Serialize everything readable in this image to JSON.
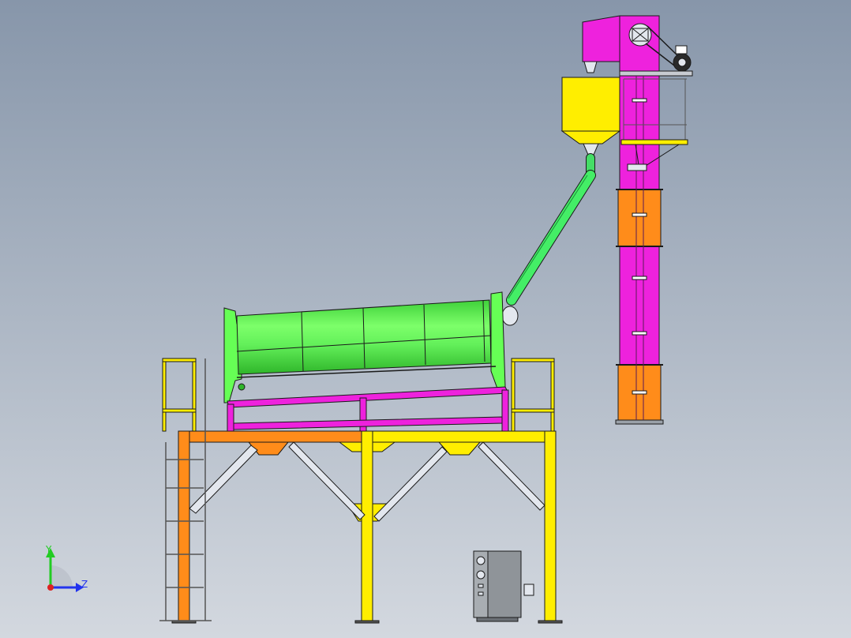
{
  "viewport": {
    "background_top": "#8796aa",
    "background_bottom": "#d3d8df"
  },
  "colors": {
    "yellow": "#ffee00",
    "orange": "#ff8c1a",
    "magenta": "#ee22dd",
    "green": "#66ff55",
    "green_dark": "#2fb52a",
    "steel": "#e3e7ee",
    "outline": "#1a1a1a",
    "control_box": "#8f9499"
  },
  "triad": {
    "y_label": "Y",
    "z_label": "Z",
    "y_color": "#22cc22",
    "z_color": "#2233ee",
    "origin_color": "#dd2222"
  },
  "components": {
    "platform": "support-platform",
    "drum": "rotary-drum",
    "chute": "feed-chute",
    "elevator": "bucket-elevator",
    "hopper": "storage-hopper",
    "control_box": "control-cabinet"
  }
}
